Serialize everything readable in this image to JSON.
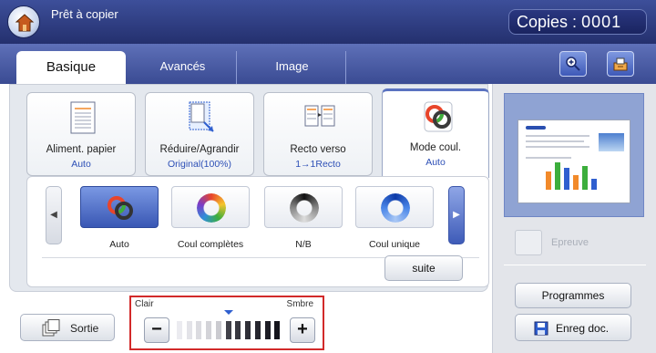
{
  "header": {
    "status": "Prêt à copier",
    "copies_label": "Copies :",
    "copies_value": "0001",
    "home_icon": "home-icon"
  },
  "tabs": [
    {
      "label": "Basique",
      "active": true
    },
    {
      "label": "Avancés",
      "active": false
    },
    {
      "label": "Image",
      "active": false
    }
  ],
  "toolbar": {
    "zoom_icon": "zoom-in-icon",
    "settings_icon": "settings-icon"
  },
  "features": [
    {
      "label": "Aliment. papier",
      "value": "Auto",
      "icon": "paper-feed-icon"
    },
    {
      "label": "Réduire/Agrandir",
      "value": "Original(100%)",
      "icon": "resize-icon"
    },
    {
      "label": "Recto verso",
      "value": "1→1Recto",
      "icon": "duplex-icon"
    },
    {
      "label": "Mode coul.",
      "value": "Auto",
      "icon": "color-mode-icon"
    }
  ],
  "color_modes": [
    {
      "label": "Auto",
      "selected": true,
      "icon": "auto-color-icon"
    },
    {
      "label": "Coul complètes",
      "selected": false,
      "icon": "full-color-icon"
    },
    {
      "label": "N/B",
      "selected": false,
      "icon": "black-white-icon"
    },
    {
      "label": "Coul unique",
      "selected": false,
      "icon": "single-color-icon"
    }
  ],
  "suite_label": "suite",
  "sortie_label": "Sortie",
  "darkness": {
    "light_label": "Clair",
    "dark_label": "Smbre",
    "minus": "−",
    "plus": "+",
    "level_fraction": 0.45
  },
  "side": {
    "epreuve_label": "Epreuve",
    "programmes_label": "Programmes",
    "enreg_label": "Enreg doc."
  },
  "colors": {
    "accent": "#2f5fcf",
    "header": "#24306e",
    "highlight": "#d22a2a"
  }
}
